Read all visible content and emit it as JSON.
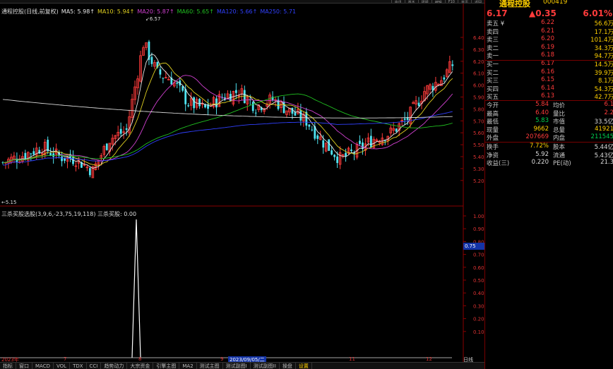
{
  "window": {
    "top_tabs": [
      "资讯",
      "基本",
      "研报",
      "编辑",
      "F10",
      "首页",
      "返回"
    ]
  },
  "chart_legend": {
    "title": "通程控股(日线,前复权)",
    "ma5": "MA5: 5.98↑",
    "ma10": "MA10: 5.94↑",
    "ma20": "MA20: 5.87↑",
    "ma60": "MA60: 5.65↑",
    "ma120": "MA120: 5.66↑",
    "ma250": "MA250: 5.71"
  },
  "price_annotations": {
    "high": "6.57",
    "low": "5.15"
  },
  "indicator_legend": {
    "text": "三杀买股选股(3,9,6,-23,75,19,118)  三杀买股: 0.00"
  },
  "y_axis_main": [
    "6.40",
    "6.30",
    "6.20",
    "6.10",
    "6.00",
    "5.90",
    "5.80",
    "5.70",
    "5.60",
    "5.50",
    "5.40",
    "5.30",
    "5.20"
  ],
  "y_axis_indicator": [
    "1.00",
    "0.90",
    "0.80",
    "0.70",
    "0.60",
    "0.50",
    "0.40",
    "0.30",
    "0.20",
    "0.10"
  ],
  "cursor_value": "0.75",
  "x_axis": [
    {
      "label": "2023年"
    },
    {
      "label": "7"
    },
    {
      "label": "8"
    },
    {
      "label": "9"
    },
    {
      "label": "2023/09/05/二",
      "highlight": true
    },
    {
      "label": "11"
    },
    {
      "label": "12"
    }
  ],
  "day_button": "日线",
  "bottom_tabs": [
    "指标",
    "窗口",
    "MACD",
    "VOL",
    "TDX",
    "CCI",
    "趋势动力",
    "大宗资金",
    "引擎主图",
    "MA2",
    "测试主图",
    "测试副图I",
    "测试副图II",
    "操盘",
    "设置"
  ],
  "quote": {
    "name": "通程控股",
    "code": "000419",
    "price": "6.17",
    "change": "▲0.35",
    "pct": "6.01%",
    "order_book": [
      {
        "label": "卖五 ¥",
        "price": "6.22",
        "vol": "56.6万"
      },
      {
        "label": "卖四",
        "price": "6.21",
        "vol": "17.1万"
      },
      {
        "label": "卖三",
        "price": "6.20",
        "vol": "101.4万"
      },
      {
        "label": "卖二",
        "price": "6.19",
        "vol": "34.3万"
      },
      {
        "label": "卖一",
        "price": "6.18",
        "vol": "94.7万"
      },
      {
        "label": "买一",
        "price": "6.17",
        "vol": "14.5万"
      },
      {
        "label": "买二",
        "price": "6.16",
        "vol": "39.9万"
      },
      {
        "label": "买三",
        "price": "6.15",
        "vol": "8.1万"
      },
      {
        "label": "买四",
        "price": "6.14",
        "vol": "54.3万"
      },
      {
        "label": "买五",
        "price": "6.13",
        "vol": "42.7万"
      }
    ],
    "stats": [
      {
        "l1": "今开",
        "v1": "5.84",
        "c1": "red",
        "l2": "均价",
        "v2": "6.1",
        "c2": "red"
      },
      {
        "l1": "最高",
        "v1": "6.40",
        "c1": "red",
        "l2": "量比",
        "v2": "2.2",
        "c2": "red"
      },
      {
        "l1": "最低",
        "v1": "5.83",
        "c1": "green",
        "l2": "市值",
        "v2": "33.5亿",
        "c2": "white"
      },
      {
        "l1": "现量",
        "v1": "9662",
        "c1": "yellow",
        "l2": "总量",
        "v2": "41921",
        "c2": "yellow"
      },
      {
        "l1": "外盘",
        "v1": "207669",
        "c1": "red",
        "l2": "内盘",
        "v2": "211545",
        "c2": "green"
      }
    ],
    "stats2": [
      {
        "l1": "换手",
        "v1": "7.72%",
        "c1": "yellow",
        "l2": "股本",
        "v2": "5.44亿",
        "c2": "white"
      },
      {
        "l1": "净资",
        "v1": "5.92",
        "c1": "white",
        "l2": "流通",
        "v2": "5.43亿",
        "c2": "white"
      },
      {
        "l1": "收益(三)",
        "v1": "0.220",
        "c1": "white",
        "l2": "PE(动)",
        "v2": "21.3",
        "c2": "white"
      }
    ]
  },
  "colors": {
    "up": "#ff3b3b",
    "down": "#4fe3f0",
    "ma5": "#e8e8e8",
    "ma10": "#e0d020",
    "ma20": "#d040d0",
    "ma60": "#20c020",
    "ma120": "#3040ff",
    "ma250": "#d8d8d8",
    "signal": "#ffffff"
  }
}
